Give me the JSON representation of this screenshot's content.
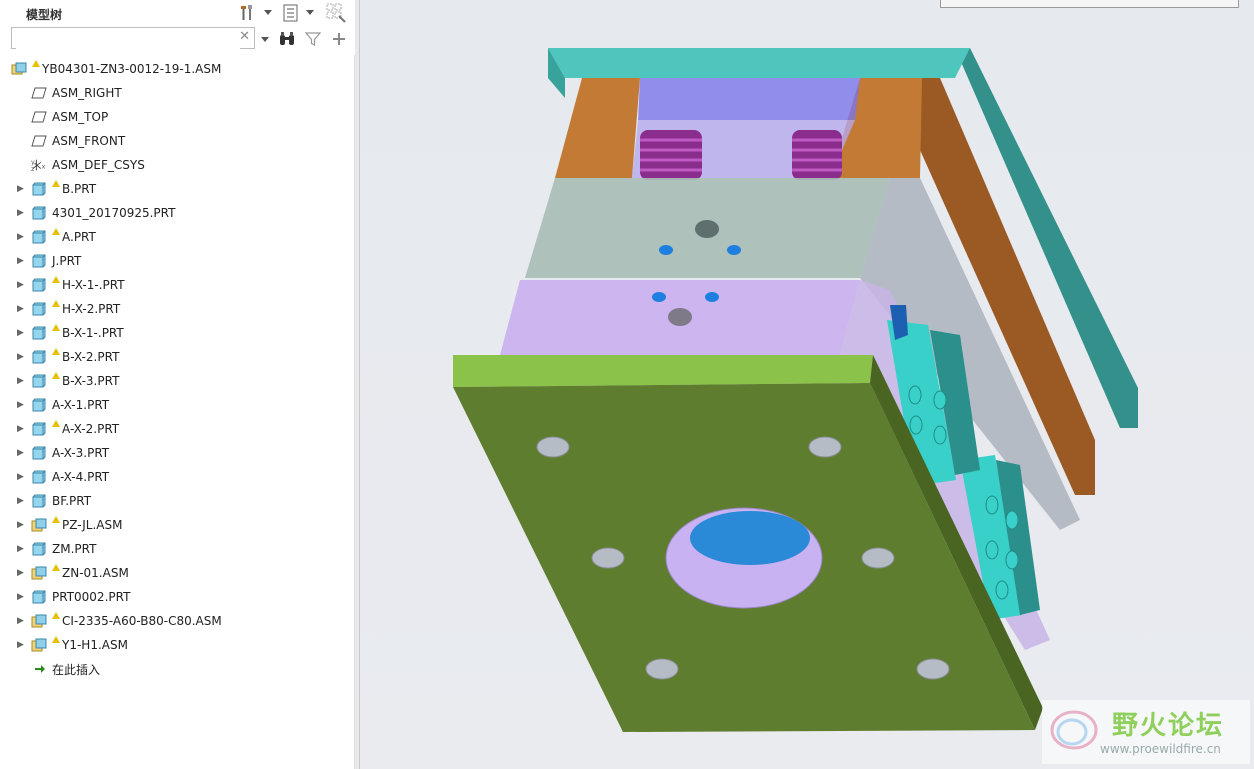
{
  "panel": {
    "title": "模型树",
    "search": {
      "value": "",
      "placeholder": ""
    }
  },
  "tree": {
    "root": {
      "label": "YB04301-ZN3-0012-19-1.ASM",
      "icon": "assembly-icon",
      "warning": true
    },
    "items": [
      {
        "label": "ASM_RIGHT",
        "icon": "datum-plane-icon",
        "expandable": false,
        "warning": false
      },
      {
        "label": "ASM_TOP",
        "icon": "datum-plane-icon",
        "expandable": false,
        "warning": false
      },
      {
        "label": "ASM_FRONT",
        "icon": "datum-plane-icon",
        "expandable": false,
        "warning": false
      },
      {
        "label": "ASM_DEF_CSYS",
        "icon": "coordinate-system-icon",
        "expandable": false,
        "warning": false
      },
      {
        "label": "B.PRT",
        "icon": "part-icon",
        "expandable": true,
        "warning": true
      },
      {
        "label": "4301_20170925.PRT",
        "icon": "part-icon",
        "expandable": true,
        "warning": false
      },
      {
        "label": "A.PRT",
        "icon": "part-icon",
        "expandable": true,
        "warning": true
      },
      {
        "label": "J.PRT",
        "icon": "part-icon",
        "expandable": true,
        "warning": false
      },
      {
        "label": "H-X-1-.PRT",
        "icon": "part-icon",
        "expandable": true,
        "warning": true
      },
      {
        "label": "H-X-2.PRT",
        "icon": "part-icon",
        "expandable": true,
        "warning": true
      },
      {
        "label": "B-X-1-.PRT",
        "icon": "part-icon",
        "expandable": true,
        "warning": true
      },
      {
        "label": "B-X-2.PRT",
        "icon": "part-icon",
        "expandable": true,
        "warning": true
      },
      {
        "label": "B-X-3.PRT",
        "icon": "part-icon",
        "expandable": true,
        "warning": true
      },
      {
        "label": "A-X-1.PRT",
        "icon": "part-icon",
        "expandable": true,
        "warning": false
      },
      {
        "label": "A-X-2.PRT",
        "icon": "part-icon",
        "expandable": true,
        "warning": true
      },
      {
        "label": "A-X-3.PRT",
        "icon": "part-icon",
        "expandable": true,
        "warning": false
      },
      {
        "label": "A-X-4.PRT",
        "icon": "part-icon",
        "expandable": true,
        "warning": false
      },
      {
        "label": "BF.PRT",
        "icon": "part-icon",
        "expandable": true,
        "warning": false
      },
      {
        "label": "PZ-JL.ASM",
        "icon": "assembly-icon",
        "expandable": true,
        "warning": true
      },
      {
        "label": "ZM.PRT",
        "icon": "part-icon",
        "expandable": true,
        "warning": false
      },
      {
        "label": "ZN-01.ASM",
        "icon": "assembly-icon",
        "expandable": true,
        "warning": true
      },
      {
        "label": "PRT0002.PRT",
        "icon": "part-icon",
        "expandable": true,
        "warning": false
      },
      {
        "label": "CI-2335-A60-B80-C80.ASM",
        "icon": "assembly-icon",
        "expandable": true,
        "warning": true
      },
      {
        "label": "Y1-H1.ASM",
        "icon": "assembly-icon",
        "expandable": true,
        "warning": true
      },
      {
        "label": "在此插入",
        "icon": "insert-here-arrow-icon",
        "expandable": false,
        "warning": false
      }
    ]
  },
  "watermark": {
    "title": "野火论坛",
    "url": "www.proewildfire.cn"
  },
  "colors": {
    "plate_green": "#5f7d2e",
    "plate_teal": "#2f9a90",
    "plate_orange": "#c27a34",
    "plate_purple": "#cdb6ef",
    "spring_purple": "#8a2d8c",
    "hole_blue": "#2a8ad8"
  }
}
